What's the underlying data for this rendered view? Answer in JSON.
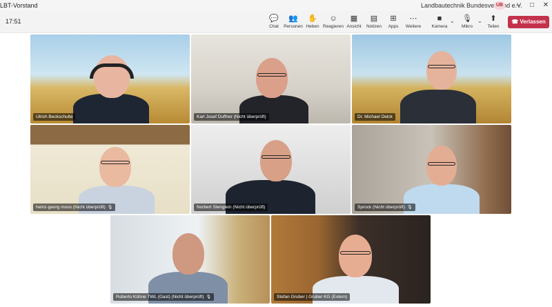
{
  "window": {
    "title": "LBT-Vorstand",
    "org": "Landbautechnik Bundesverband e.V.",
    "user_badge": "UB",
    "min": "–",
    "max": "□",
    "close": "✕"
  },
  "toolbar": {
    "time": "17:51",
    "items": [
      {
        "label": "Chat",
        "icon": "💬"
      },
      {
        "label": "Personen",
        "icon": "👥"
      },
      {
        "label": "Heben",
        "icon": "✋"
      },
      {
        "label": "Reagieren",
        "icon": "☺"
      },
      {
        "label": "Ansicht",
        "icon": "▦"
      },
      {
        "label": "Notizen",
        "icon": "▤"
      },
      {
        "label": "Apps",
        "icon": "⊞"
      },
      {
        "label": "Weitere",
        "icon": "⋯"
      },
      {
        "label": "Kamera",
        "icon": "■"
      },
      {
        "label": "Mikro",
        "icon": "🎙"
      },
      {
        "label": "Teilen",
        "icon": "⬆"
      }
    ],
    "leave_label": "Verlassen",
    "leave_icon": "☎",
    "chevron": "⌄"
  },
  "participants": [
    {
      "name": "Ulrich Beckschulte",
      "muted": false
    },
    {
      "name": "Karl Josef Duffner (Nicht überprüft)",
      "muted": false
    },
    {
      "name": "Dr. Michael Oelck",
      "muted": false
    },
    {
      "name": "heinz-georg moos (Nicht überprüft)",
      "muted": true
    },
    {
      "name": "Norbert Stenglein (Nicht überprüft)",
      "muted": false
    },
    {
      "name": "Sprock (Nicht überprüft)",
      "muted": true
    },
    {
      "name": "Roberto Kühne TWL (Gast) (Nicht überprüft)",
      "muted": true
    },
    {
      "name": "Stefan Gruber | Gruber KG (Extern)",
      "muted": false
    }
  ],
  "mic_icon": "🎙"
}
